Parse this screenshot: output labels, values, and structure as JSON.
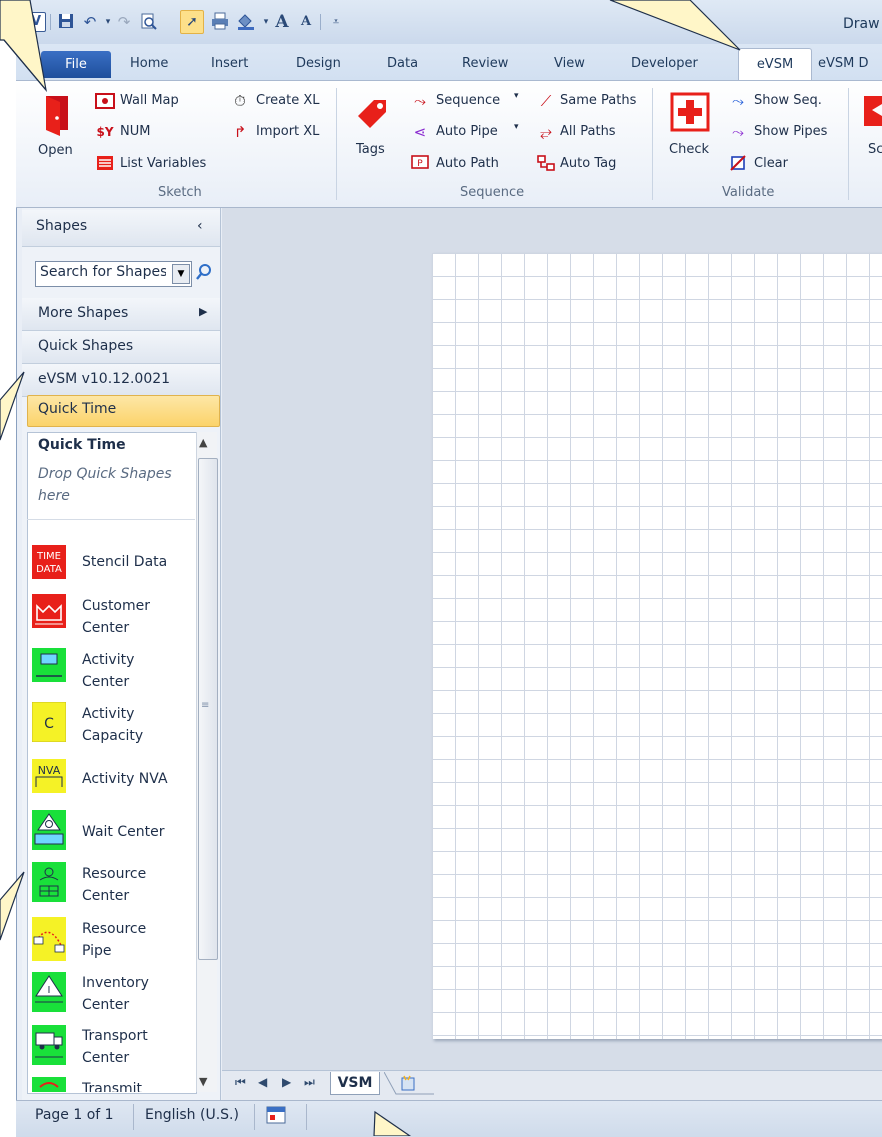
{
  "title_bar": {
    "app_icon_letter": "V",
    "doc_title": "Draw"
  },
  "tabs": [
    "File",
    "Home",
    "Insert",
    "Design",
    "Data",
    "Review",
    "View",
    "Developer",
    "eVSM",
    "eVSM D"
  ],
  "ribbon": {
    "sketch": {
      "open_label": "Open",
      "wall_map": "Wall Map",
      "num": "NUM",
      "list_variables": "List Variables",
      "create_xl": "Create XL",
      "import_xl": "Import XL",
      "group_name": "Sketch"
    },
    "sequence": {
      "tags": "Tags",
      "sequence": "Sequence",
      "auto_pipe": "Auto Pipe",
      "auto_path": "Auto Path",
      "same_paths": "Same Paths",
      "all_paths": "All Paths",
      "auto_tag": "Auto Tag",
      "group_name": "Sequence"
    },
    "validate": {
      "check": "Check",
      "show_seq": "Show Seq.",
      "show_pipes": "Show Pipes",
      "clear": "Clear",
      "group_name": "Validate"
    },
    "partial_label": "Sc"
  },
  "shapes_panel": {
    "title": "Shapes",
    "search_placeholder": "Search for Shapes",
    "more_shapes": "More Shapes",
    "quick_shapes": "Quick Shapes",
    "version": "eVSM v10.12.0021",
    "active_stencil": "Quick Time",
    "stencil_heading": "Quick Time",
    "drop_hint": "Drop Quick Shapes here",
    "items": [
      {
        "line1": "Stencil Data",
        "line2": "",
        "icon_text": "TIME DATA",
        "color": "#e8201a"
      },
      {
        "line1": "Customer",
        "line2": "Center",
        "icon_text": "",
        "color": "#e8201a"
      },
      {
        "line1": "Activity",
        "line2": "Center",
        "icon_text": "",
        "color": "#19e03a"
      },
      {
        "line1": "Activity",
        "line2": "Capacity",
        "icon_text": "C",
        "color": "#f5f226"
      },
      {
        "line1": "Activity NVA",
        "line2": "",
        "icon_text": "NVA",
        "color": "#f5f226"
      },
      {
        "line1": "Wait Center",
        "line2": "",
        "icon_text": "",
        "color": "#19e03a"
      },
      {
        "line1": "Resource",
        "line2": "Center",
        "icon_text": "",
        "color": "#19e03a"
      },
      {
        "line1": "Resource",
        "line2": "Pipe",
        "icon_text": "",
        "color": "#f5f226"
      },
      {
        "line1": "Inventory",
        "line2": "Center",
        "icon_text": "I",
        "color": "#19e03a"
      },
      {
        "line1": "Transport",
        "line2": "Center",
        "icon_text": "",
        "color": "#19e03a"
      },
      {
        "line1": "Transmit",
        "line2": "",
        "icon_text": "",
        "color": "#19e03a"
      }
    ]
  },
  "sheet_tabs": {
    "active": "VSM"
  },
  "status_bar": {
    "page": "Page 1 of 1",
    "language": "English (U.S.)"
  }
}
